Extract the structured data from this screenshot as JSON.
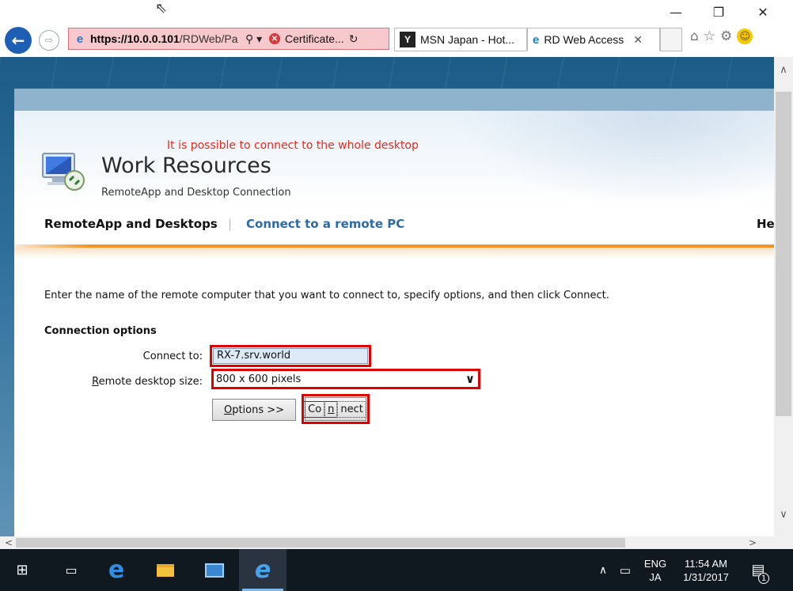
{
  "window": {
    "minimize": "—",
    "maximize": "❐",
    "close": "✕"
  },
  "browser": {
    "back_icon": "back-arrow-icon",
    "forward_icon": "forward-arrow-icon",
    "address": {
      "url_host": "https://10.0.0.101",
      "url_path": "/RDWeb/Pa",
      "cert_label": "Certificate...",
      "state_color": "#f7c8cc"
    },
    "tabs": [
      {
        "label": "MSN Japan - Hot..."
      },
      {
        "label": "RD Web Access",
        "close": "✕"
      }
    ]
  },
  "page": {
    "annotation": "It is possible to connect to the whole desktop",
    "title": "Work Resources",
    "subtitle": "RemoteApp and Desktop Connection",
    "nav": {
      "item1": "RemoteApp and Desktops",
      "separator": "|",
      "item2": "Connect to a remote PC",
      "item3": "He"
    },
    "instruction": "Enter the name of the remote computer that you want to connect to, specify options, and then click Connect.",
    "connection_options": "Connection options",
    "connect_to_label": "Connect to:",
    "connect_to_value": "RX-7.srv.world",
    "size_label_u": "R",
    "size_label_rest": "emote desktop size:",
    "size_value": "800 x 600 pixels",
    "options_button_u": "O",
    "options_button_rest": "ptions >>",
    "connect_button_pre": "Co",
    "connect_button_u": "n",
    "connect_button_rest": "nect",
    "highlight_color": "#e00000",
    "accent_color": "#f39323"
  },
  "taskbar": {
    "lang_top": "ENG",
    "lang_bottom": "JA",
    "time": "11:54 AM",
    "date": "1/31/2017",
    "notif_count": "1"
  }
}
